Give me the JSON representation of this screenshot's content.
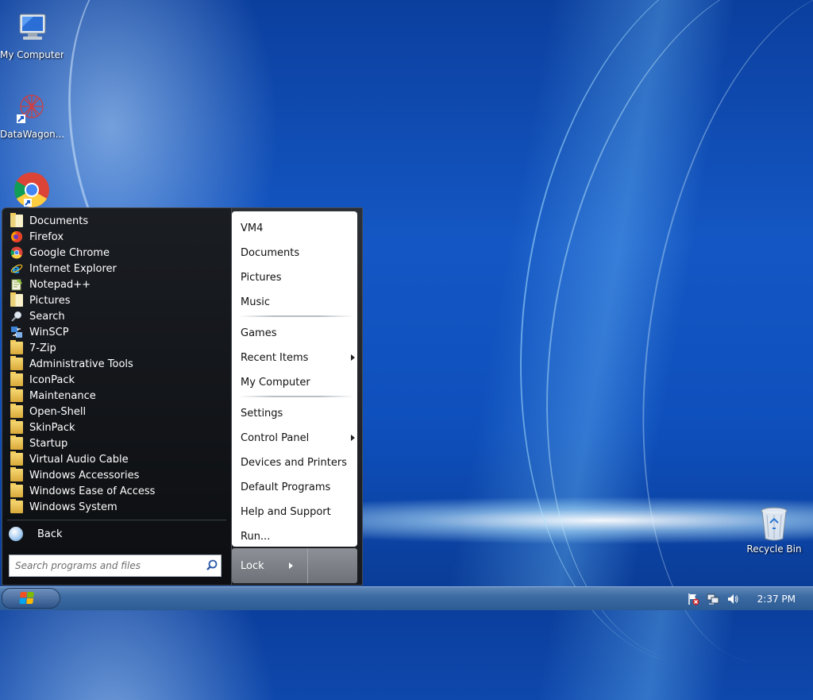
{
  "desktop": {
    "icons": [
      {
        "label": "My Computer",
        "icon": "computer-icon"
      },
      {
        "label": "DataWagon...",
        "icon": "datawagon-icon"
      },
      {
        "label": "",
        "icon": "chrome-icon"
      },
      {
        "label": "Recycle Bin",
        "icon": "recycle-bin-icon"
      }
    ]
  },
  "start_menu": {
    "programs": [
      {
        "label": "Documents",
        "icon": "folder-icon"
      },
      {
        "label": "Firefox",
        "icon": "firefox-icon"
      },
      {
        "label": "Google Chrome",
        "icon": "chrome-icon"
      },
      {
        "label": "Internet Explorer",
        "icon": "internet-explorer-icon"
      },
      {
        "label": "Notepad++",
        "icon": "notepad-plus-plus-icon"
      },
      {
        "label": "Pictures",
        "icon": "folder-icon"
      },
      {
        "label": "Search",
        "icon": "search-icon"
      },
      {
        "label": "WinSCP",
        "icon": "winscp-icon"
      },
      {
        "label": "7-Zip",
        "icon": "folder-icon"
      },
      {
        "label": "Administrative Tools",
        "icon": "folder-icon"
      },
      {
        "label": "IconPack",
        "icon": "folder-icon"
      },
      {
        "label": "Maintenance",
        "icon": "folder-icon"
      },
      {
        "label": "Open-Shell",
        "icon": "folder-icon"
      },
      {
        "label": "SkinPack",
        "icon": "folder-icon"
      },
      {
        "label": "Startup",
        "icon": "folder-icon"
      },
      {
        "label": "Virtual Audio Cable",
        "icon": "folder-icon"
      },
      {
        "label": "Windows Accessories",
        "icon": "folder-icon"
      },
      {
        "label": "Windows Ease of Access",
        "icon": "folder-icon"
      },
      {
        "label": "Windows System",
        "icon": "folder-icon"
      }
    ],
    "back_label": "Back",
    "search_placeholder": "Search programs and files",
    "right_items": {
      "user": "VM4",
      "documents": "Documents",
      "pictures": "Pictures",
      "music": "Music",
      "games": "Games",
      "recent_items": "Recent Items",
      "my_computer": "My Computer",
      "settings": "Settings",
      "control_panel": "Control Panel",
      "devices_printers": "Devices and Printers",
      "default_programs": "Default Programs",
      "help_support": "Help and Support",
      "run": "Run..."
    },
    "lock_label": "Lock"
  },
  "taskbar": {
    "clock": "2:37 PM",
    "tray_icons": [
      "flag-warning-icon",
      "network-icon",
      "volume-icon"
    ]
  },
  "colors": {
    "desktop_blue": "#1457c4",
    "menu_dark": "#121418",
    "taskbar": "#3c6ba3"
  }
}
